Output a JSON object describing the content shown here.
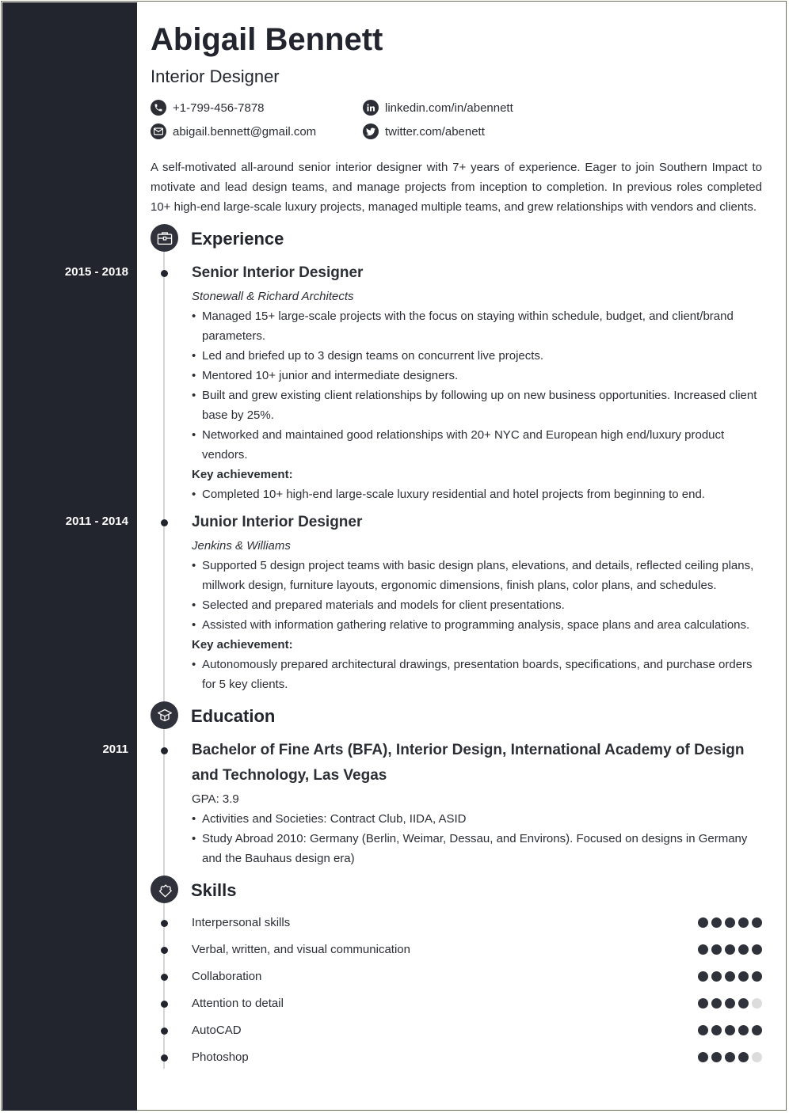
{
  "header": {
    "name": "Abigail Bennett",
    "title": "Interior Designer"
  },
  "contacts": [
    {
      "icon": "phone-icon",
      "text": "+1-799-456-7878"
    },
    {
      "icon": "linkedin-icon",
      "text": "linkedin.com/in/abennett"
    },
    {
      "icon": "email-icon",
      "text": "abigail.bennett@gmail.com"
    },
    {
      "icon": "twitter-icon",
      "text": "twitter.com/abenett"
    }
  ],
  "summary": "A self-motivated all-around senior interior designer with 7+ years of experience. Eager to join Southern Impact to motivate and lead design teams, and manage projects from inception to completion. In previous roles completed 10+ high-end large-scale luxury projects, managed multiple teams, and grew relationships with vendors and clients.",
  "experience": {
    "heading": "Experience",
    "icon": "briefcase-icon",
    "jobs": [
      {
        "dates": "2015 - 2018",
        "title": "Senior Interior Designer",
        "company": "Stonewall & Richard Architects",
        "bullets": [
          "Managed 15+ large-scale projects with the focus on staying within schedule, budget, and client/brand parameters.",
          "Led and briefed up to 3 design teams on concurrent live projects.",
          "Mentored 10+ junior and intermediate designers.",
          "Built and grew existing client relationships by following up on new business opportunities. Increased client base by 25%.",
          "Networked and maintained good relationships with 20+ NYC and European high end/luxury product vendors."
        ],
        "key_label": "Key achievement:",
        "key_bullets": [
          "Completed 10+ high-end large-scale luxury residential and hotel projects from beginning to end."
        ]
      },
      {
        "dates": "2011 - 2014",
        "title": "Junior Interior Designer",
        "company": "Jenkins & Williams",
        "bullets": [
          "Supported 5 design project teams with basic design plans, elevations, and details, reflected ceiling plans, millwork design, furniture layouts, ergonomic dimensions, finish plans, color plans, and schedules.",
          "Selected and prepared materials and models for client presentations.",
          "Assisted with information gathering relative to programming analysis, space plans and area calculations."
        ],
        "key_label": "Key achievement:",
        "key_bullets": [
          "Autonomously prepared architectural drawings, presentation boards, specifications, and purchase orders for 5 key clients."
        ]
      }
    ]
  },
  "education": {
    "heading": "Education",
    "icon": "graduation-cap-icon",
    "entries": [
      {
        "dates": "2011",
        "title": "Bachelor of Fine Arts (BFA), Interior Design, International Academy of Design and Technology, Las Vegas",
        "gpa": "GPA: 3.9",
        "bullets": [
          "Activities and Societies: Contract Club, IIDA, ASID",
          "Study Abroad 2010: Germany (Berlin, Weimar, Dessau, and Environs). Focused on designs in Germany and the Bauhaus design era)"
        ]
      }
    ]
  },
  "skills": {
    "heading": "Skills",
    "icon": "puzzle-piece-icon",
    "max_rating": 5,
    "items": [
      {
        "name": "Interpersonal skills",
        "rating": 5
      },
      {
        "name": "Verbal, written, and visual communication",
        "rating": 5
      },
      {
        "name": "Collaboration",
        "rating": 5
      },
      {
        "name": "Attention to detail",
        "rating": 4
      },
      {
        "name": "AutoCAD",
        "rating": 5
      },
      {
        "name": "Photoshop",
        "rating": 4
      }
    ]
  },
  "colors": {
    "sidebar": "#22252d",
    "accent": "#2f323a",
    "rating_off": "#dcdcdc",
    "timeline": "#d5d6d8"
  }
}
